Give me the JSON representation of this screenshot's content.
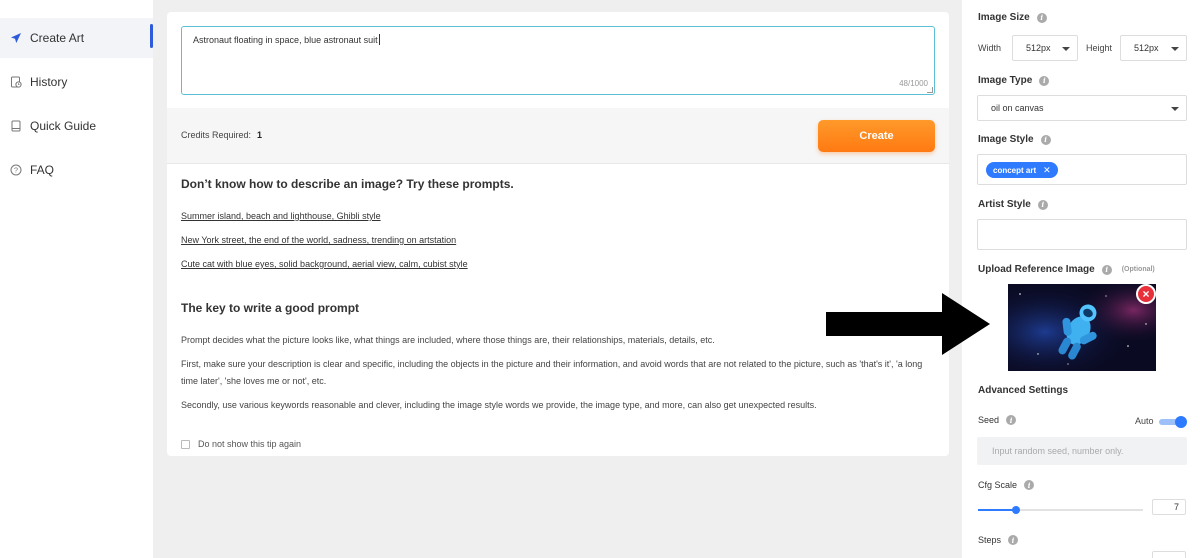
{
  "sidebar": {
    "items": [
      {
        "label": "Create Art",
        "icon": "send-icon",
        "active": true
      },
      {
        "label": "History",
        "icon": "history-icon",
        "active": false
      },
      {
        "label": "Quick Guide",
        "icon": "book-icon",
        "active": false
      },
      {
        "label": "FAQ",
        "icon": "question-icon",
        "active": false
      }
    ]
  },
  "prompt": {
    "value": "Astronaut floating in space, blue astronaut suit",
    "count": "48/1000"
  },
  "credits": {
    "label": "Credits Required:",
    "value": "1",
    "create_label": "Create"
  },
  "tips": {
    "heading": "Don’t know how to describe an image? Try these prompts.",
    "examples": [
      "Summer island, beach and lighthouse, Ghibli style",
      "New York street, the end of the world, sadness, trending on artstation",
      "Cute cat with blue eyes, solid background, aerial view, calm, cubist style"
    ],
    "key_heading": "The key to write a good prompt",
    "paragraphs": [
      "Prompt decides what the picture looks like, what things are included, where those things are, their relationships, materials, details, etc.",
      "First, make sure your description is clear and specific, including the objects in the picture and their information, and avoid words that are not related to the picture, such as 'that's it', 'a long time later', 'she loves me or not', etc.",
      "Secondly, use various keywords reasonable and clever, including the image style words we provide, the image type, and more, can also get unexpected results."
    ],
    "checkbox_label": "Do not show this tip again"
  },
  "settings": {
    "image_size": {
      "label": "Image Size",
      "width_label": "Width",
      "width_value": "512px",
      "height_label": "Height",
      "height_value": "512px"
    },
    "image_type": {
      "label": "Image Type",
      "value": "oil on canvas"
    },
    "image_style": {
      "label": "Image Style",
      "tag": "concept art",
      "tag_close": "✕"
    },
    "artist_style": {
      "label": "Artist Style"
    },
    "upload": {
      "label": "Upload Reference Image",
      "optional": "(Optional)",
      "remove": "×"
    },
    "advanced": {
      "label": "Advanced Settings"
    },
    "seed": {
      "label": "Seed",
      "auto_label": "Auto",
      "auto_on": true,
      "placeholder": "Input random seed, number only."
    },
    "cfg": {
      "label": "Cfg Scale",
      "value": "7",
      "fraction": 0.23
    },
    "steps": {
      "label": "Steps"
    },
    "info_glyph": "i"
  },
  "colors": {
    "accent": "#2e7bff",
    "create_button": "#ff8a1f",
    "active_nav": "#2d5bdb",
    "remove_badge": "#e8303a"
  }
}
